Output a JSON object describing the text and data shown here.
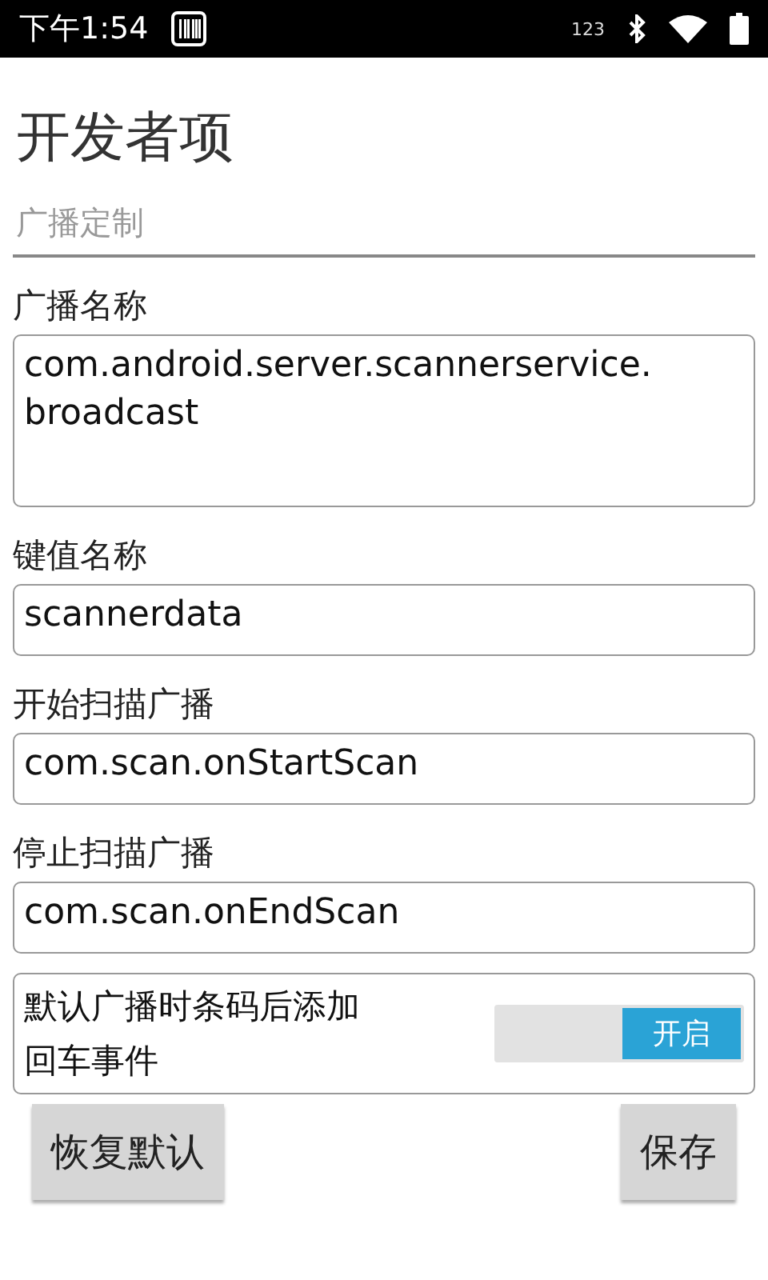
{
  "status_bar": {
    "time": "下午1:54",
    "indicator": "123"
  },
  "title": "开发者项",
  "section": "广播定制",
  "fields": [
    {
      "label": "广播名称",
      "value": "com.android.server.scannerservice.\nbroadcast",
      "kind": "multiline"
    },
    {
      "label": "键值名称",
      "value": "scannerdata",
      "kind": "single"
    },
    {
      "label": "开始扫描广播",
      "value": "com.scan.onStartScan",
      "kind": "single"
    },
    {
      "label": "停止扫描广播",
      "value": "com.scan.onEndScan",
      "kind": "single"
    }
  ],
  "switch": {
    "label": "默认广播时条码后添加回车事件",
    "on": true,
    "state_text": "开启"
  },
  "buttons": [
    "恢复默认",
    "保存"
  ]
}
